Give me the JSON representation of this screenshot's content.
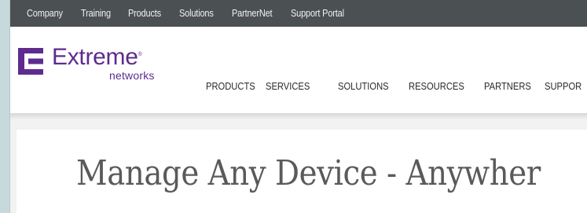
{
  "utility_nav": {
    "items": [
      {
        "label": "Company"
      },
      {
        "label": "Training"
      },
      {
        "label": "Products"
      },
      {
        "label": "Solutions"
      },
      {
        "label": "PartnerNet"
      },
      {
        "label": "Support Portal"
      }
    ]
  },
  "brand": {
    "name": "Extreme",
    "sub": "networks",
    "color": "#5e2b8f"
  },
  "main_nav": {
    "items": [
      {
        "label": "PRODUCTS"
      },
      {
        "label": "SERVICES"
      },
      {
        "label": "SOLUTIONS"
      },
      {
        "label": "RESOURCES"
      },
      {
        "label": "PARTNERS"
      },
      {
        "label": "SUPPOR"
      }
    ]
  },
  "hero": {
    "title": "Manage Any Device - Anywher"
  },
  "colors": {
    "utility_bar": "#4b5053",
    "page_bg": "#f2f2f2",
    "outer_bg": "#c9dcdd"
  }
}
